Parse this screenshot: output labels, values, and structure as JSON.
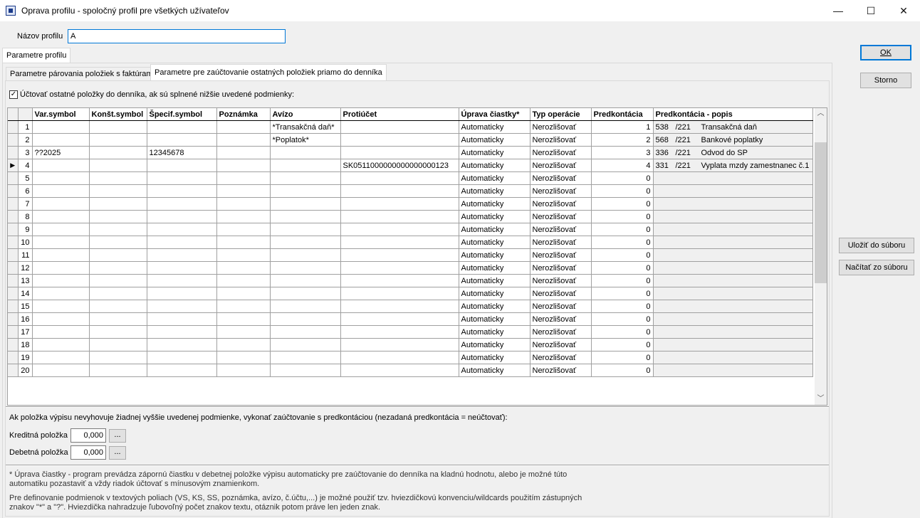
{
  "window": {
    "title": "Oprava profilu - spoločný profil pre všetkých užívateľov",
    "minimize": "—",
    "maximize": "☐",
    "close": "✕"
  },
  "profile": {
    "name_label": "Názov profilu",
    "name_value": "A"
  },
  "outer_tab": "Parametre profilu",
  "tabs": [
    "Parametre párovania položiek s faktúrami",
    "Parametre pre zaúčtovanie ostatných položiek priamo do denníka"
  ],
  "checkbox": {
    "checked": true,
    "label": "Účtovať ostatné položky do denníka, ak sú splnené nižšie uvedené podmienky:"
  },
  "grid": {
    "columns": [
      "Var.symbol",
      "Konšt.symbol",
      "Špecif.symbol",
      "Poznámka",
      "Avízo",
      "Protiúčet",
      "Úprava čiastky*",
      "Typ operácie",
      "Predkontácia",
      "Predkontácia - popis"
    ],
    "rows": [
      {
        "n": "1",
        "var": "",
        "konst": "",
        "spec": "",
        "pozn": "",
        "avizo": "*Transakčná daň*",
        "proti": "",
        "uprava": "Automaticky",
        "typ": "Nerozlišovať",
        "pred": "1",
        "dcode": "538",
        "dacc": "/221",
        "dtext": "Transakčná daň"
      },
      {
        "n": "2",
        "var": "",
        "konst": "",
        "spec": "",
        "pozn": "",
        "avizo": "*Poplatok*",
        "proti": "",
        "uprava": "Automaticky",
        "typ": "Nerozlišovať",
        "pred": "2",
        "dcode": "568",
        "dacc": "/221",
        "dtext": "Bankové poplatky"
      },
      {
        "n": "3",
        "var": "??2025",
        "konst": "",
        "spec": "12345678",
        "pozn": "",
        "avizo": "",
        "proti": "",
        "uprava": "Automaticky",
        "typ": "Nerozlišovať",
        "pred": "3",
        "dcode": "336",
        "dacc": "/221",
        "dtext": "Odvod do SP"
      },
      {
        "n": "4",
        "var": "",
        "konst": "",
        "spec": "",
        "pozn": "",
        "avizo": "",
        "proti": "SK0511000000000000000123",
        "uprava": "Automaticky",
        "typ": "Nerozlišovať",
        "pred": "4",
        "dcode": "331",
        "dacc": "/221",
        "dtext": "Vyplata mzdy zamestnanec č.1"
      },
      {
        "n": "5",
        "uprava": "Automaticky",
        "typ": "Nerozlišovať",
        "pred": "0"
      },
      {
        "n": "6",
        "uprava": "Automaticky",
        "typ": "Nerozlišovať",
        "pred": "0"
      },
      {
        "n": "7",
        "uprava": "Automaticky",
        "typ": "Nerozlišovať",
        "pred": "0"
      },
      {
        "n": "8",
        "uprava": "Automaticky",
        "typ": "Nerozlišovať",
        "pred": "0"
      },
      {
        "n": "9",
        "uprava": "Automaticky",
        "typ": "Nerozlišovať",
        "pred": "0"
      },
      {
        "n": "10",
        "uprava": "Automaticky",
        "typ": "Nerozlišovať",
        "pred": "0"
      },
      {
        "n": "11",
        "uprava": "Automaticky",
        "typ": "Nerozlišovať",
        "pred": "0"
      },
      {
        "n": "12",
        "uprava": "Automaticky",
        "typ": "Nerozlišovať",
        "pred": "0"
      },
      {
        "n": "13",
        "uprava": "Automaticky",
        "typ": "Nerozlišovať",
        "pred": "0"
      },
      {
        "n": "14",
        "uprava": "Automaticky",
        "typ": "Nerozlišovať",
        "pred": "0"
      },
      {
        "n": "15",
        "uprava": "Automaticky",
        "typ": "Nerozlišovať",
        "pred": "0"
      },
      {
        "n": "16",
        "uprava": "Automaticky",
        "typ": "Nerozlišovať",
        "pred": "0"
      },
      {
        "n": "17",
        "uprava": "Automaticky",
        "typ": "Nerozlišovať",
        "pred": "0"
      },
      {
        "n": "18",
        "uprava": "Automaticky",
        "typ": "Nerozlišovať",
        "pred": "0"
      },
      {
        "n": "19",
        "uprava": "Automaticky",
        "typ": "Nerozlišovať",
        "pred": "0"
      },
      {
        "n": "20",
        "uprava": "Automaticky",
        "typ": "Nerozlišovať",
        "pred": "0"
      }
    ],
    "current_row_marker": "▶"
  },
  "fallback": {
    "text": "Ak položka výpisu nevyhovuje žiadnej vyššie uvedenej podmienke, vykonať zaúčtovanie s predkontáciou (nezadaná predkontácia = neúčtovať):",
    "credit_label": "Kreditná položka",
    "credit_value": "0,000",
    "debit_label": "Debetná položka",
    "debit_value": "0,000",
    "browse": "..."
  },
  "notes": {
    "note1_line1": "* Úprava čiastky - program prevádza zápornú čiastku v debetnej položke výpisu automaticky pre zaúčtovanie do denníka na kladnú hodnotu, alebo je možné túto",
    "note1_line2": "automatiku pozastaviť a vždy riadok účtovať s mínusovým znamienkom.",
    "note2_line1": "Pre definovanie podmienok v textových poliach (VS, KS, SS, poznámka, avízo, č.účtu,...) je možné použiť tzv. hviezdičkovú konvenciu/wildcards použitím zástupných",
    "note2_line2": "znakov \"*\" a \"?\". Hviezdička nahradzuje ľubovoľný počet znakov textu, otáznik potom práve len jeden znak."
  },
  "buttons": {
    "ok": "OK",
    "cancel": "Storno",
    "save_file": "Uložiť do súboru",
    "load_file": "Načítať zo súboru"
  }
}
